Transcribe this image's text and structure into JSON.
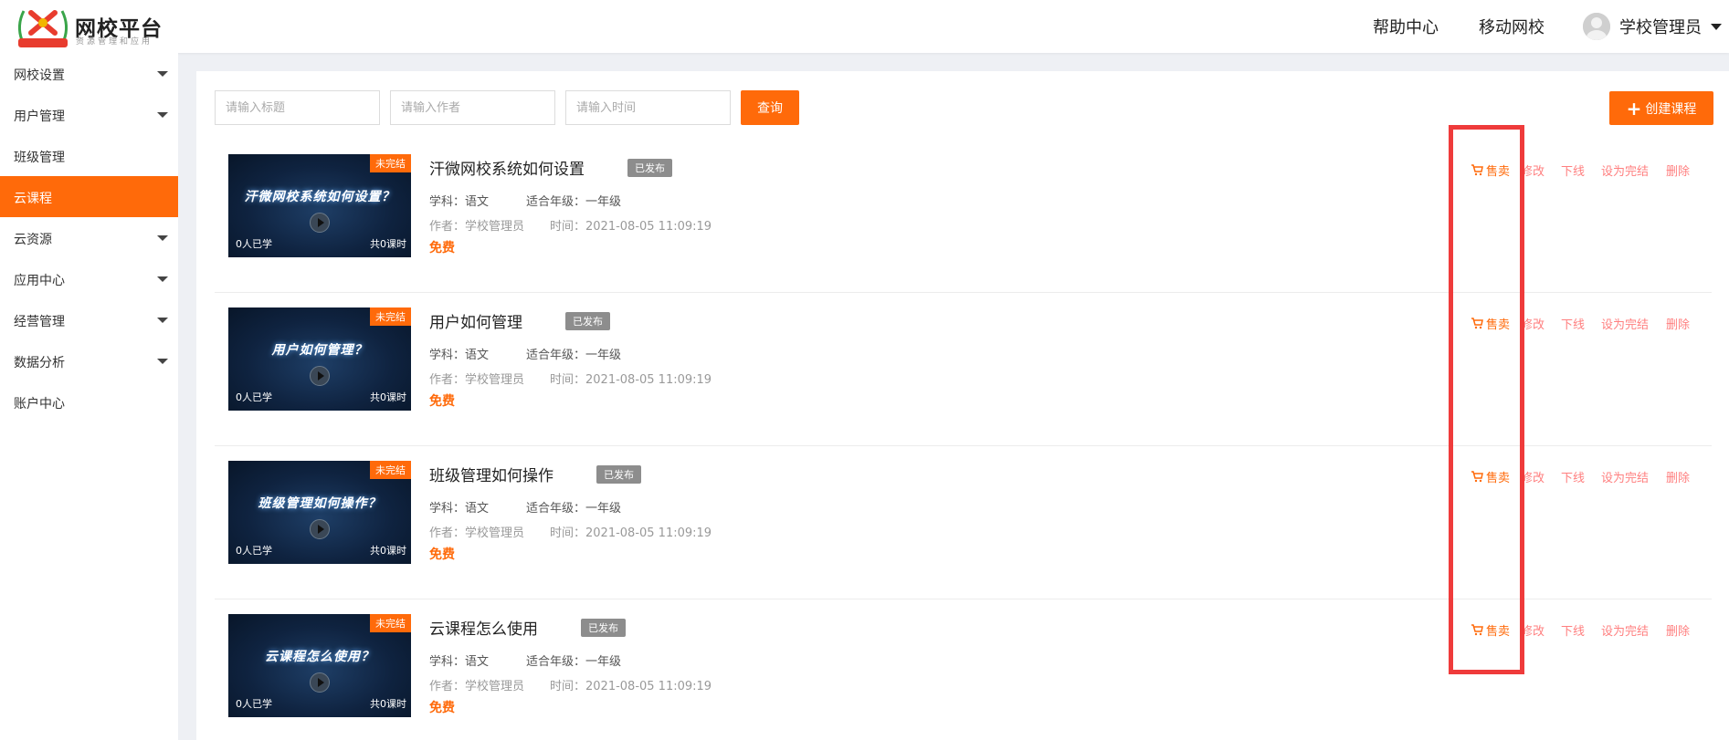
{
  "header": {
    "brand_title": "网校平台",
    "brand_subtitle": "资源管理和应用",
    "logo_ribbon": "网校平台",
    "nav_help": "帮助中心",
    "nav_mobile": "移动网校",
    "user_name": "学校管理员",
    "accent": "#ff6a0a"
  },
  "sidebar": {
    "items": [
      {
        "label": "网校设置",
        "has_arrow": true,
        "active": false
      },
      {
        "label": "用户管理",
        "has_arrow": true,
        "active": false
      },
      {
        "label": "班级管理",
        "has_arrow": false,
        "active": false
      },
      {
        "label": "云课程",
        "has_arrow": false,
        "active": true
      },
      {
        "label": "云资源",
        "has_arrow": true,
        "active": false
      },
      {
        "label": "应用中心",
        "has_arrow": true,
        "active": false
      },
      {
        "label": "经营管理",
        "has_arrow": true,
        "active": false
      },
      {
        "label": "数据分析",
        "has_arrow": true,
        "active": false
      },
      {
        "label": "账户中心",
        "has_arrow": false,
        "active": false
      }
    ]
  },
  "filters": {
    "title_placeholder": "请输入标题",
    "author_placeholder": "请输入作者",
    "time_placeholder": "请输入时间",
    "query_label": "查询",
    "create_label": "创建课程"
  },
  "courses": [
    {
      "thumb_text": "汗微网校系统如何设置？",
      "unfinished": "未完结",
      "learned": "0人已学",
      "lessons": "共0课时",
      "title": "汗微网校系统如何设置",
      "status": "已发布",
      "subject": "学科：语文",
      "grade": "适合年级：一年级",
      "author": "作者：学校管理员",
      "time": "时间：2021-08-05 11:09:19",
      "price": "免费"
    },
    {
      "thumb_text": "用户如何管理？",
      "unfinished": "未完结",
      "learned": "0人已学",
      "lessons": "共0课时",
      "title": "用户如何管理",
      "status": "已发布",
      "subject": "学科：语文",
      "grade": "适合年级：一年级",
      "author": "作者：学校管理员",
      "time": "时间：2021-08-05 11:09:19",
      "price": "免费"
    },
    {
      "thumb_text": "班级管理如何操作？",
      "unfinished": "未完结",
      "learned": "0人已学",
      "lessons": "共0课时",
      "title": "班级管理如何操作",
      "status": "已发布",
      "subject": "学科：语文",
      "grade": "适合年级：一年级",
      "author": "作者：学校管理员",
      "time": "时间：2021-08-05 11:09:19",
      "price": "免费"
    },
    {
      "thumb_text": "云课程怎么使用？",
      "unfinished": "未完结",
      "learned": "0人已学",
      "lessons": "共0课时",
      "title": "云课程怎么使用",
      "status": "已发布",
      "subject": "学科：语文",
      "grade": "适合年级：一年级",
      "author": "作者：学校管理员",
      "time": "时间：2021-08-05 11:09:19",
      "price": "免费"
    }
  ],
  "actions": {
    "sell": "售卖",
    "edit": "修改",
    "offline": "下线",
    "finish": "设为完结",
    "delete": "删除",
    "icon": "cart-icon"
  }
}
